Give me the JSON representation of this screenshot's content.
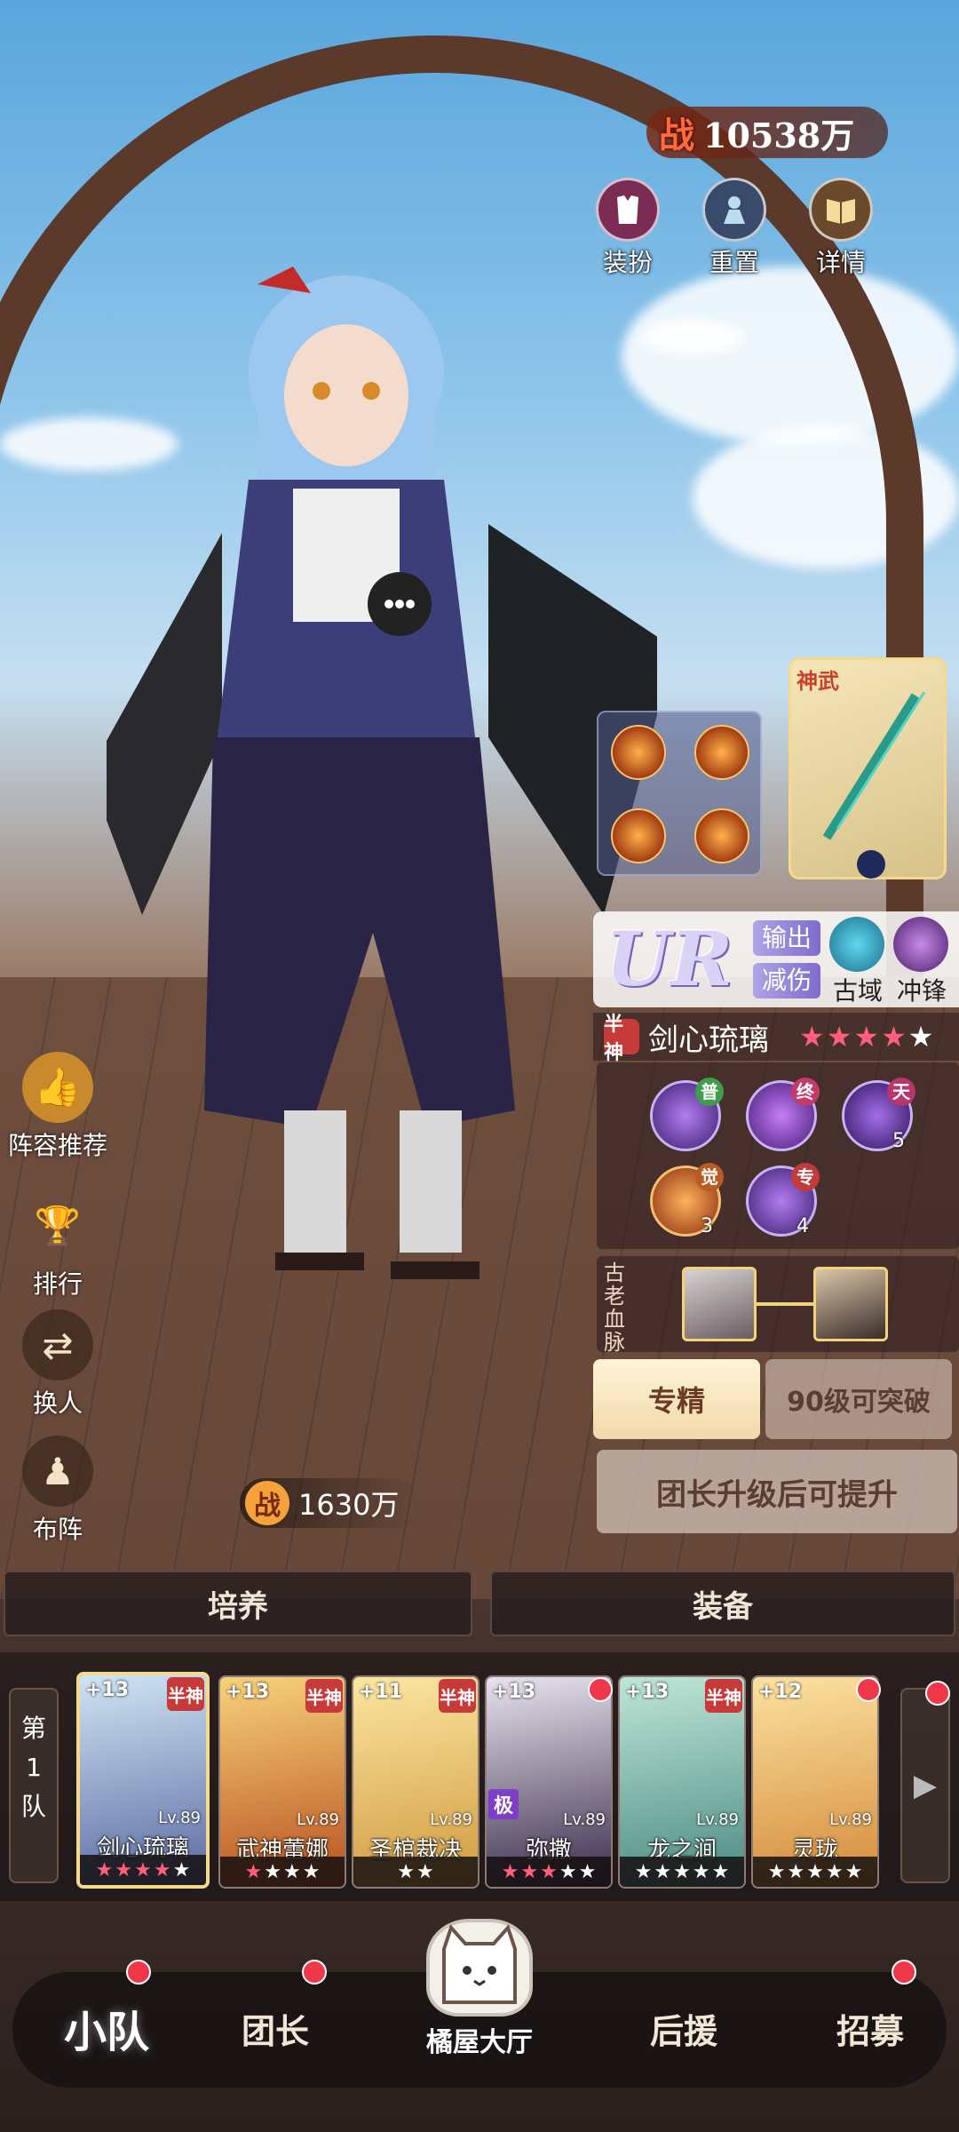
{
  "header": {
    "power_label": "战",
    "power_value": "10538万",
    "buttons": [
      {
        "label": "装扮",
        "icon": "dress-icon"
      },
      {
        "label": "重置",
        "icon": "reset-icon"
      },
      {
        "label": "详情",
        "icon": "book-icon"
      }
    ]
  },
  "left_menu": [
    {
      "label": "阵容推荐",
      "icon": "thumbs-up-icon"
    },
    {
      "label": "排行",
      "icon": "trophy-icon"
    },
    {
      "label": "换人",
      "icon": "swap-icon"
    },
    {
      "label": "布阵",
      "icon": "formation-icon"
    }
  ],
  "character": {
    "weapon_tag": "神武",
    "rarity": "UR",
    "roles": [
      "输出",
      "减伤"
    ],
    "elements": [
      {
        "label": "古域",
        "color": "#1fa8c9"
      },
      {
        "label": "冲锋",
        "color": "#7b3bb5"
      }
    ],
    "half_god": "半神",
    "name": "剑心琉璃",
    "stars_red": 4,
    "stars_white": 1,
    "skills": [
      {
        "badge": "普",
        "badge_color": "#3f9d4c",
        "num": ""
      },
      {
        "badge": "终",
        "badge_color": "#c23b6a",
        "num": ""
      },
      {
        "badge": "天",
        "badge_color": "#b7366b",
        "num": "5"
      },
      {
        "badge": "觉",
        "badge_color": "#b85c23",
        "num": "3"
      },
      {
        "badge": "专",
        "badge_color": "#c23b3b",
        "num": "4"
      }
    ],
    "bloodline_label": "古老血脉",
    "power_label": "战",
    "power_value": "1630万"
  },
  "actions": {
    "specialize": "专精",
    "breakthrough": "90级可突破",
    "upgrade_hint": "团长升级后可提升"
  },
  "tabs": [
    "培养",
    "装备"
  ],
  "team": {
    "label_lines": [
      "第",
      "1",
      "队"
    ],
    "members": [
      {
        "name": "剑心琉璃",
        "plus": "+13",
        "lv": "Lv.89",
        "half_god": true,
        "ji": false,
        "red": 4,
        "white": 1,
        "palette": [
          "#cfe4f4",
          "#5a6aa0"
        ]
      },
      {
        "name": "武神蕾娜",
        "plus": "+13",
        "lv": "Lv.89",
        "half_god": true,
        "ji": false,
        "red": 1,
        "white": 3,
        "palette": [
          "#f7d27a",
          "#b8501f"
        ]
      },
      {
        "name": "圣棺裁决",
        "plus": "+11",
        "lv": "Lv.89",
        "half_god": true,
        "ji": false,
        "red": 0,
        "white": 2,
        "palette": [
          "#fbe6a0",
          "#d19a40"
        ]
      },
      {
        "name": "弥撒",
        "plus": "+13",
        "lv": "Lv.89",
        "half_god": false,
        "ji": true,
        "red": 3,
        "white": 2,
        "palette": [
          "#e7e3ee",
          "#3a2c4a"
        ]
      },
      {
        "name": "龙之涧",
        "plus": "+13",
        "lv": "Lv.89",
        "half_god": true,
        "ji": false,
        "red": 0,
        "white": 5,
        "palette": [
          "#bfe6d6",
          "#4a8a82"
        ]
      },
      {
        "name": "灵珑",
        "plus": "+12",
        "lv": "Lv.89",
        "half_god": false,
        "ji": false,
        "red": 0,
        "white": 5,
        "palette": [
          "#fbe2a0",
          "#d48a3a"
        ]
      }
    ]
  },
  "nav": {
    "items": [
      "小队",
      "团长",
      "后援",
      "招募"
    ],
    "center": "橘屋大厅"
  }
}
